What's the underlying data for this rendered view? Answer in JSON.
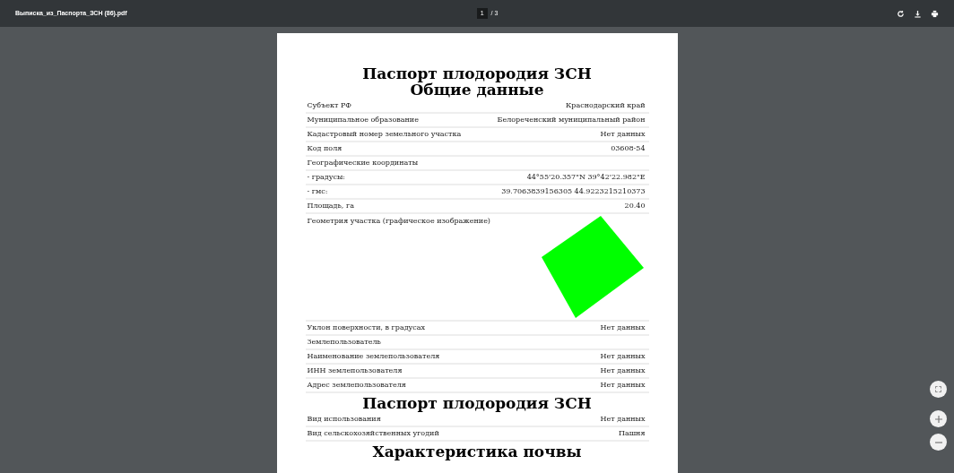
{
  "toolbar": {
    "filename": "Выписка_из_Паспорта_ЗСН (86).pdf",
    "page": "1",
    "page_total": "/ 3"
  },
  "sections": [
    {
      "headings": [
        "Паспорт плодородия ЗСН",
        "Общие данные"
      ],
      "rows": [
        {
          "kind": "text",
          "label": "Субъект РФ",
          "value": "Краснодарский край"
        },
        {
          "kind": "text",
          "label": "Муниципальное образование",
          "value": "Белореченский муниципальный район"
        },
        {
          "kind": "text",
          "label": "Кадастровый номер земельного участка",
          "value": "Нет данных"
        },
        {
          "kind": "text",
          "label": "Код поля",
          "value": "03608-54"
        },
        {
          "kind": "text",
          "label": "Географические координаты"
        },
        {
          "kind": "text",
          "label": "- градусы:",
          "value": "44°55'20.357\"N 39°42'22.982\"E"
        },
        {
          "kind": "text",
          "label": "- гмс:",
          "value": "39.7063839156305 44.9223215210373"
        },
        {
          "kind": "text",
          "label": "Площадь, га",
          "value": "20.40"
        },
        {
          "kind": "geometry",
          "label": "Геометрия участка (графическое изображение)"
        },
        {
          "kind": "text",
          "label": "Уклон поверхности, в градусах",
          "value": "Нет данных"
        },
        {
          "kind": "text",
          "label": "Землепользователь"
        },
        {
          "kind": "text",
          "label": "Наименование землепользователя",
          "value": "Нет данных"
        },
        {
          "kind": "text",
          "label": "ИНН землепользователя",
          "value": "Нет данных"
        },
        {
          "kind": "text",
          "label": "Адрес землепользователя",
          "value": "Нет данных"
        }
      ]
    },
    {
      "headings": [
        "Паспорт плодородия ЗСН"
      ],
      "rows": [
        {
          "kind": "text",
          "label": "Вид использования",
          "value": "Нет данных"
        },
        {
          "kind": "text",
          "label": "Вид сельскохозяйственных угодий",
          "value": "Пашня"
        }
      ]
    },
    {
      "headings": [
        "Характеристика почвы"
      ]
    }
  ]
}
